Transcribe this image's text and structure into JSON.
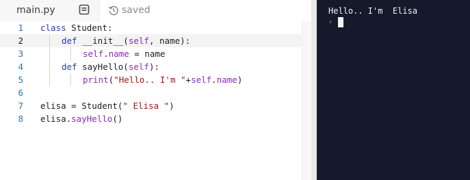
{
  "tab": {
    "filename": "main.py",
    "status": "saved"
  },
  "editor": {
    "lines": [
      {
        "num": "1",
        "tokens": [
          {
            "t": "kw",
            "v": "class"
          },
          {
            "t": "plain",
            "v": " Student:"
          }
        ]
      },
      {
        "num": "2",
        "tokens": [
          {
            "t": "kw",
            "v": "def"
          },
          {
            "t": "plain",
            "v": " __init__("
          },
          {
            "t": "self",
            "v": "self"
          },
          {
            "t": "plain",
            "v": ", name):"
          }
        ]
      },
      {
        "num": "3",
        "tokens": [
          {
            "t": "self",
            "v": "self"
          },
          {
            "t": "plain",
            "v": "."
          },
          {
            "t": "self",
            "v": "name"
          },
          {
            "t": "plain",
            "v": " = name"
          }
        ]
      },
      {
        "num": "4",
        "tokens": [
          {
            "t": "kw",
            "v": "def"
          },
          {
            "t": "plain",
            "v": " sayHello("
          },
          {
            "t": "self",
            "v": "self"
          },
          {
            "t": "plain",
            "v": "):"
          }
        ]
      },
      {
        "num": "5",
        "tokens": [
          {
            "t": "call",
            "v": "print"
          },
          {
            "t": "plain",
            "v": "("
          },
          {
            "t": "str",
            "v": "\"Hello.. I'm \""
          },
          {
            "t": "plain",
            "v": "+"
          },
          {
            "t": "self",
            "v": "self"
          },
          {
            "t": "plain",
            "v": "."
          },
          {
            "t": "self",
            "v": "name"
          },
          {
            "t": "plain",
            "v": ")"
          }
        ]
      },
      {
        "num": "6",
        "tokens": []
      },
      {
        "num": "7",
        "tokens": [
          {
            "t": "plain",
            "v": "elisa = Student("
          },
          {
            "t": "str",
            "v": "\" Elisa \""
          },
          {
            "t": "plain",
            "v": ")"
          }
        ]
      },
      {
        "num": "8",
        "tokens": [
          {
            "t": "plain",
            "v": "elisa."
          },
          {
            "t": "call",
            "v": "sayHello"
          },
          {
            "t": "plain",
            "v": "()"
          }
        ]
      }
    ],
    "active_line": "2"
  },
  "console": {
    "output": "Hello.. I'm  Elisa",
    "prompt_icon": "chevron-right-icon",
    "prompt_glyph": "›"
  },
  "colors": {
    "keyword": "#1f3fa8",
    "self": "#8b2bb9",
    "string": "#a31515",
    "console_bg": "#141a2b",
    "prompt": "#f26a2e"
  }
}
